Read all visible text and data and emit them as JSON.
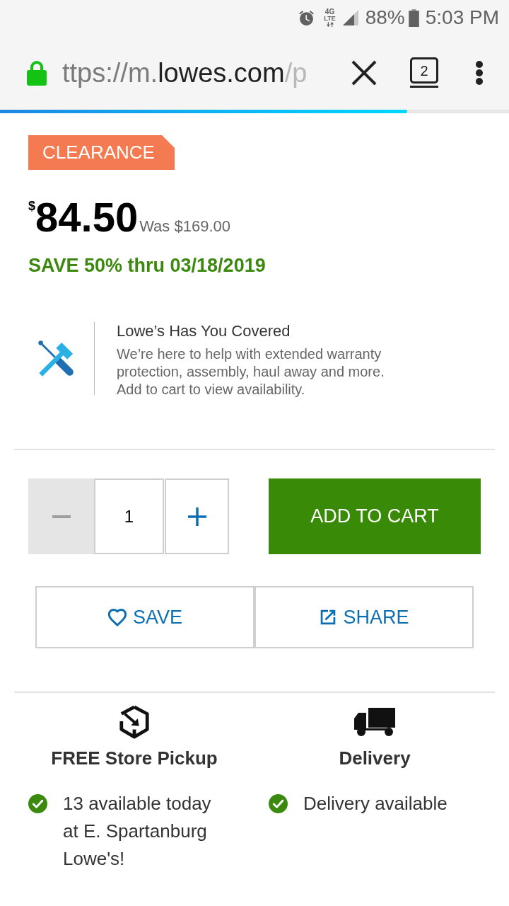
{
  "status_bar": {
    "network": {
      "generation": "4G",
      "tech": "LTE"
    },
    "battery": "88%",
    "time": "5:03 PM"
  },
  "browser": {
    "url": {
      "scheme": "ttps://m.",
      "host": "lowes.com",
      "path": "/p"
    },
    "tab_count": "2",
    "page_load": {
      "level": 0.8
    }
  },
  "product": {
    "badge": "CLEARANCE",
    "price": {
      "currency": "$",
      "amount": "84.50",
      "was": "Was $169.00"
    },
    "savings": "SAVE 50% thru 03/18/2019"
  },
  "services": {
    "title": "Lowe’s Has You Covered",
    "description": "We’re here to help with extended warranty protection, assembly, haul away and more. Add to cart to view availability."
  },
  "quantity": {
    "value": "1",
    "decrease_disabled": true
  },
  "add_to_cart": "ADD TO CART",
  "actions": [
    {
      "kind": "save",
      "label": "SAVE"
    },
    {
      "kind": "share",
      "label": "SHARE"
    }
  ],
  "fulfillment": [
    {
      "kind": "pickup",
      "title": "FREE Store Pickup",
      "status": {
        "text": "13 available today at E. Spartanburg Lowe's!",
        "available": true
      }
    },
    {
      "kind": "delivery",
      "title": "Delivery",
      "status": {
        "text": "Delivery available",
        "available": true
      }
    }
  ]
}
